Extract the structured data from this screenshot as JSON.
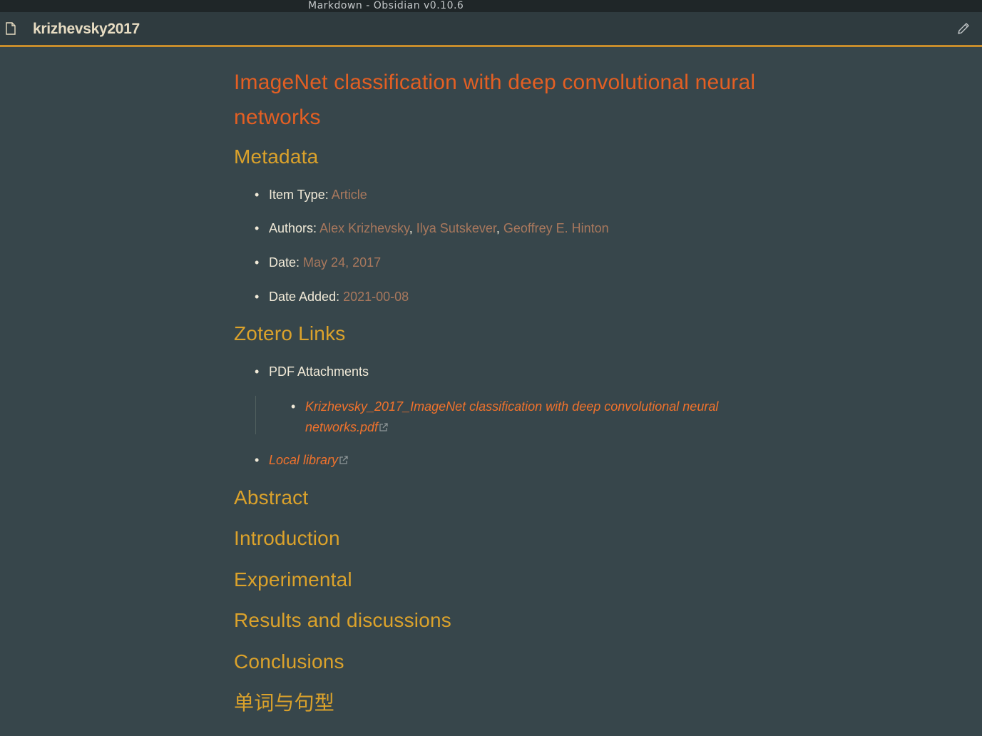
{
  "window": {
    "title": "Markdown - Obsidian v0.10.6"
  },
  "view": {
    "file_icon": "file-icon",
    "title": "krizhevsky2017",
    "edit_icon": "pencil-icon"
  },
  "note": {
    "title": "ImageNet classification with deep convolutional neural networks",
    "sections": {
      "metadata": "Metadata",
      "zotero_links": "Zotero Links",
      "abstract": "Abstract",
      "introduction": "Introduction",
      "experimental": "Experimental",
      "results": "Results and discussions",
      "conclusions": "Conclusions",
      "vocab": "单词与句型"
    },
    "metadata": {
      "item_type_label": "Item Type:",
      "item_type_value": "Article",
      "authors_label": "Authors:",
      "authors": [
        "Alex Krizhevsky",
        "Ilya Sutskever",
        "Geoffrey E. Hinton"
      ],
      "author_separator": ",",
      "date_label": "Date:",
      "date_value": "May 24, 2017",
      "date_added_label": "Date Added:",
      "date_added_value": "2021-00-08"
    },
    "zotero": {
      "pdf_attachments_label": "PDF Attachments",
      "pdf_link": "Krizhevsky_2017_ImageNet classification with deep convolutional neural networks.pdf",
      "local_library_link": "Local library",
      "external_link_icon": "external-link-icon"
    },
    "bullet": "•"
  },
  "colors": {
    "background": "#37464b",
    "titlebar": "#1f2628",
    "header": "#2f3b3f",
    "header_accent": "#c88d2c",
    "h1": "#e35f23",
    "h2": "#dba22b",
    "text": "#f1ead8",
    "value": "#a9785d",
    "link": "#f0722c"
  }
}
